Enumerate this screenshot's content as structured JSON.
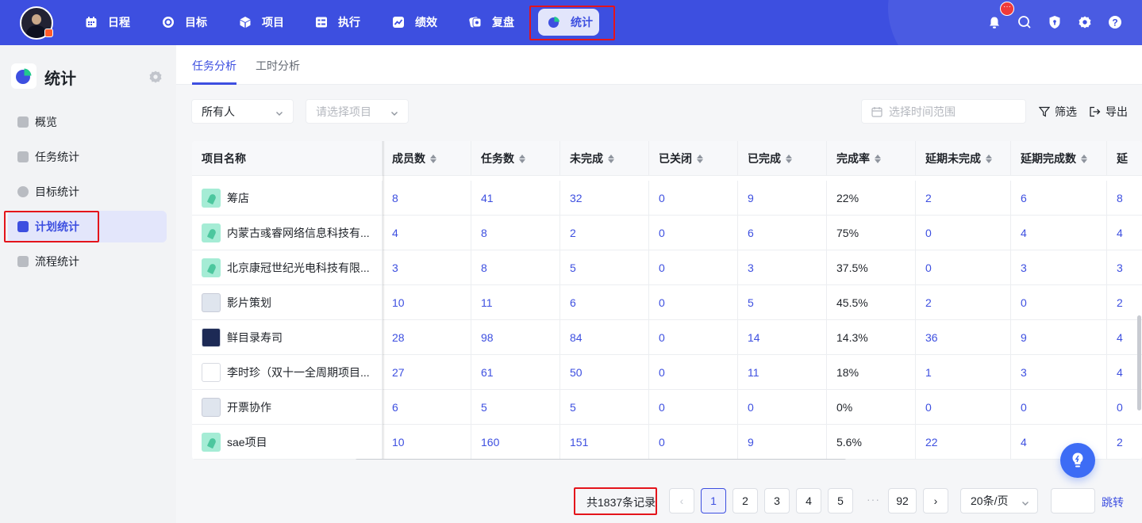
{
  "nav": {
    "items": [
      {
        "label": "日程",
        "icon": "calendar-icon"
      },
      {
        "label": "目标",
        "icon": "target-icon"
      },
      {
        "label": "项目",
        "icon": "cube-icon"
      },
      {
        "label": "执行",
        "icon": "checklist-icon"
      },
      {
        "label": "绩效",
        "icon": "chart-line-icon"
      },
      {
        "label": "复盘",
        "icon": "review-icon"
      },
      {
        "label": "统计",
        "icon": "pie-chart-icon"
      }
    ],
    "active_label": "统计",
    "notify_badge": "···"
  },
  "sidebar": {
    "title": "统计",
    "items": [
      {
        "label": "概览"
      },
      {
        "label": "任务统计"
      },
      {
        "label": "目标统计"
      },
      {
        "label": "计划统计"
      },
      {
        "label": "流程统计"
      }
    ],
    "active_label": "计划统计"
  },
  "tabs": [
    {
      "label": "任务分析"
    },
    {
      "label": "工时分析"
    }
  ],
  "filters": {
    "owner_value": "所有人",
    "project_placeholder": "请选择项目",
    "date_placeholder": "选择时间范围",
    "filter_label": "筛选",
    "export_label": "导出"
  },
  "table": {
    "columns": [
      "项目名称",
      "成员数",
      "任务数",
      "未完成",
      "已关闭",
      "已完成",
      "完成率",
      "延期未完成",
      "延期完成数",
      "延"
    ],
    "rows": [
      {
        "name": "筹店",
        "thumb": "green",
        "members": "8",
        "tasks": "41",
        "unfinished": "32",
        "closed": "0",
        "done": "9",
        "rate": "22%",
        "delayed_unfinished": "2",
        "delayed_done": "6",
        "more": "8"
      },
      {
        "name": "内蒙古彧睿网络信息科技有...",
        "thumb": "green",
        "members": "4",
        "tasks": "8",
        "unfinished": "2",
        "closed": "0",
        "done": "6",
        "rate": "75%",
        "delayed_unfinished": "0",
        "delayed_done": "4",
        "more": "4"
      },
      {
        "name": "北京康冠世纪光电科技有限...",
        "thumb": "green",
        "members": "3",
        "tasks": "8",
        "unfinished": "5",
        "closed": "0",
        "done": "3",
        "rate": "37.5%",
        "delayed_unfinished": "0",
        "delayed_done": "3",
        "more": "3"
      },
      {
        "name": "影片策划",
        "thumb": "light",
        "members": "10",
        "tasks": "11",
        "unfinished": "6",
        "closed": "0",
        "done": "5",
        "rate": "45.5%",
        "delayed_unfinished": "2",
        "delayed_done": "0",
        "more": "2"
      },
      {
        "name": "鲜目录寿司",
        "thumb": "dark",
        "members": "28",
        "tasks": "98",
        "unfinished": "84",
        "closed": "0",
        "done": "14",
        "rate": "14.3%",
        "delayed_unfinished": "36",
        "delayed_done": "9",
        "more": "4"
      },
      {
        "name": "李时珍（双十一全周期项目...",
        "thumb": "white",
        "members": "27",
        "tasks": "61",
        "unfinished": "50",
        "closed": "0",
        "done": "11",
        "rate": "18%",
        "delayed_unfinished": "1",
        "delayed_done": "3",
        "more": "4"
      },
      {
        "name": "开票协作",
        "thumb": "light",
        "members": "6",
        "tasks": "5",
        "unfinished": "5",
        "closed": "0",
        "done": "0",
        "rate": "0%",
        "delayed_unfinished": "0",
        "delayed_done": "0",
        "more": "0"
      },
      {
        "name": "sae项目",
        "thumb": "green",
        "members": "10",
        "tasks": "160",
        "unfinished": "151",
        "closed": "0",
        "done": "9",
        "rate": "5.6%",
        "delayed_unfinished": "22",
        "delayed_done": "4",
        "more": "2"
      }
    ]
  },
  "pagination": {
    "total_text": "共1837条记录",
    "prev": "‹",
    "next": "›",
    "pages": [
      "1",
      "2",
      "3",
      "4",
      "5"
    ],
    "ellipsis": "···",
    "last_page": "92",
    "current": "1",
    "page_size": "20条/页",
    "jump_label": "跳转"
  },
  "colors": {
    "primary": "#3d4fe0",
    "highlight_box": "#e4141b"
  }
}
